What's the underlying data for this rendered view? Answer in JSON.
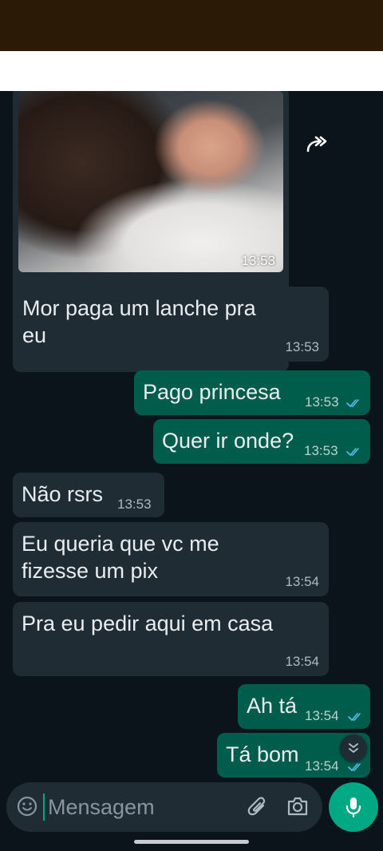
{
  "icons": {
    "forward": "forward-icon",
    "scroll_down": "double-chevron-down-icon",
    "emoji": "emoji-icon",
    "attach": "paperclip-icon",
    "camera": "camera-icon",
    "mic": "microphone-icon",
    "read": "double-check-icon"
  },
  "colors": {
    "incoming_bubble": "#202c33",
    "outgoing_bubble": "#005c4b",
    "accent": "#00a884",
    "read_ticks": "#53bdeb"
  },
  "image_message": {
    "time": "13:53"
  },
  "messages": [
    {
      "direction": "in",
      "text": "Mor paga um lanche pra\neu",
      "time": "13:53"
    },
    {
      "direction": "out",
      "text": "Pago princesa",
      "time": "13:53",
      "status": "read"
    },
    {
      "direction": "out",
      "text": "Quer ir onde?",
      "time": "13:53",
      "status": "read"
    },
    {
      "direction": "in",
      "text": "Não rsrs",
      "time": "13:53"
    },
    {
      "direction": "in",
      "text": "Eu queria que vc me\nfizesse um pix",
      "time": "13:54"
    },
    {
      "direction": "in",
      "text": "Pra eu pedir aqui em casa",
      "time": "13:54"
    },
    {
      "direction": "out",
      "text": "Ah tá",
      "time": "13:54",
      "status": "read"
    },
    {
      "direction": "out",
      "text": "Tá bom",
      "time": "13:54",
      "status": "read"
    }
  ],
  "composer": {
    "placeholder": "Mensagem"
  }
}
